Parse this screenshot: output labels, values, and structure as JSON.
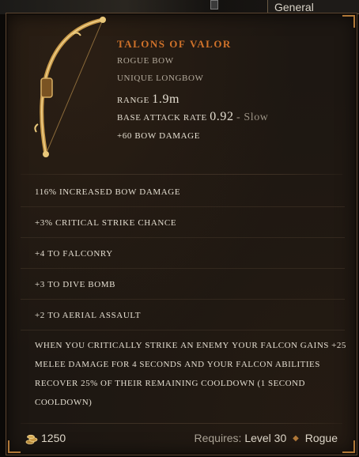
{
  "background": {
    "tab_label": "General"
  },
  "item": {
    "name": "Talons of Valor",
    "type": "Rogue Bow",
    "rarity": "Unique Longbow",
    "range_label": "Range",
    "range_value": "1.9m",
    "attack_rate_label": "Base Attack Rate",
    "attack_rate_value": "0.92",
    "attack_rate_speed": "- Slow",
    "implicit": "+60 Bow Damage",
    "icon": "longbow-icon",
    "name_color": "#d0722a"
  },
  "affixes": [
    "116% increased Bow Damage",
    "+3% Critical Strike Chance",
    "+4 to Falconry",
    "+3 to Dive Bomb",
    "+2 to Aerial Assault"
  ],
  "unique_power": "When you Critically Strike an enemy your Falcon gains +25 Melee Damage for 4 seconds and your Falcon Abilities recover 25% of their remaining cooldown (1 second cooldown)",
  "footer": {
    "gold_icon": "gold-coins-icon",
    "gold_value": "1250",
    "requires_label": "Requires:",
    "requires_level": "Level 30",
    "requires_class": "Rogue"
  }
}
